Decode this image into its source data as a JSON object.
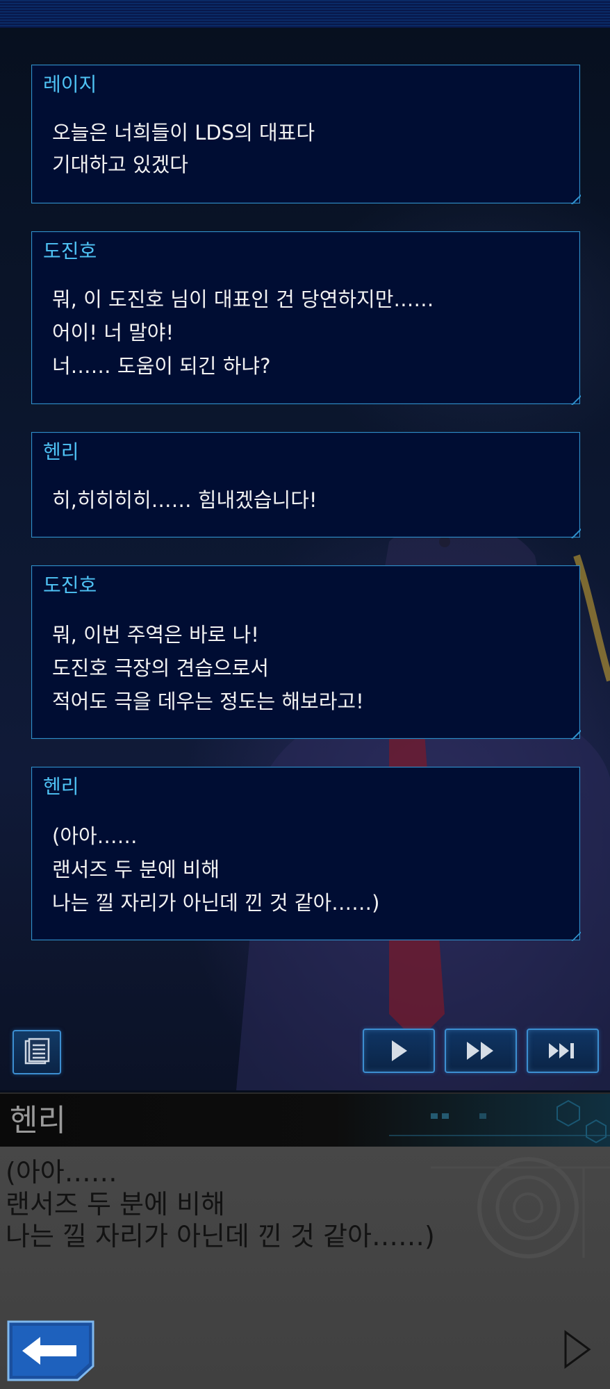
{
  "log": [
    {
      "speaker": "레이지",
      "lines": [
        "오늘은 너희들이 LDS의 대표다",
        "기대하고 있겠다"
      ]
    },
    {
      "speaker": "도진호",
      "lines": [
        "뭐, 이 도진호 님이 대표인 건 당연하지만……",
        "어이! 너 말야!",
        "너…… 도움이 되긴 하냐?"
      ]
    },
    {
      "speaker": "헨리",
      "lines": [
        "히,히히히히…… 힘내겠습니다!"
      ]
    },
    {
      "speaker": "도진호",
      "lines": [
        "뭐, 이번 주역은 바로 나!",
        "도진호 극장의 견습으로서",
        "적어도 극을 데우는 정도는 해보라고!"
      ]
    },
    {
      "speaker": "헨리",
      "lines": [
        "(아아……",
        "랜서즈 두 분에 비해",
        "나는 낄 자리가 아닌데 낀 것 같아……)"
      ]
    }
  ],
  "controls": {
    "log_icon": "document-list-icon",
    "play_icon": "play-icon",
    "fast_forward_icon": "fast-forward-icon",
    "skip_icon": "skip-to-end-icon"
  },
  "text_window": {
    "speaker": "헨리",
    "lines": [
      "(아아……",
      "랜서즈 두 분에 비해",
      "나는 낄 자리가 아닌데 낀 것 같아……)"
    ],
    "back_icon": "back-arrow-icon",
    "next_icon": "next-triangle-icon"
  },
  "colors": {
    "speaker_name": "#4fc3f5",
    "log_border": "#2f8fc9",
    "log_background": "#000d33",
    "text_window_background": "#454545"
  }
}
